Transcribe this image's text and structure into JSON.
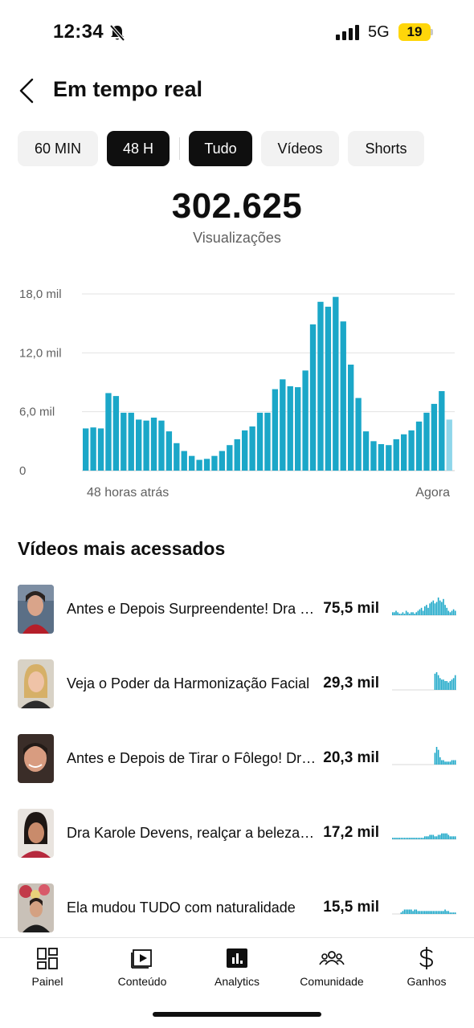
{
  "status_bar": {
    "time": "12:34",
    "network": "5G",
    "battery": "19"
  },
  "header": {
    "title": "Em tempo real"
  },
  "filters": {
    "range": [
      {
        "label": "60 MIN",
        "active": false
      },
      {
        "label": "48 H",
        "active": true
      }
    ],
    "content": [
      {
        "label": "Tudo",
        "active": true
      },
      {
        "label": "Vídeos",
        "active": false
      },
      {
        "label": "Shorts",
        "active": false
      }
    ]
  },
  "summary": {
    "total": "302.625",
    "label": "Visualizações"
  },
  "chart_data": {
    "type": "bar",
    "y_ticks": [
      "18,0 mil",
      "12,0 mil",
      "6,0 mil",
      "0"
    ],
    "ylim": [
      0,
      18000
    ],
    "x_start_label": "48 horas atrás",
    "x_end_label": "Agora",
    "values": [
      4300,
      4400,
      4300,
      7900,
      7600,
      5900,
      5900,
      5200,
      5100,
      5400,
      5100,
      4000,
      2800,
      2000,
      1500,
      1100,
      1200,
      1500,
      2000,
      2600,
      3200,
      4100,
      4500,
      5900,
      5900,
      8300,
      9300,
      8600,
      8500,
      10200,
      14900,
      17200,
      16700,
      17700,
      15200,
      10800,
      7400,
      4000,
      3000,
      2700,
      2600,
      3200,
      3700,
      4100,
      5000,
      5900,
      6800,
      8100,
      5200
    ],
    "bar_color": "#1ba7c8",
    "last_bar_color": "#8fd6ea",
    "grid": true
  },
  "top_videos": {
    "title": "Vídeos mais acessados",
    "items": [
      {
        "title": "Antes e Depois Surpreendente! Dra Karole Devens",
        "views": "75,5 mil",
        "spark": [
          2,
          2,
          3,
          2,
          1,
          1,
          2,
          1,
          3,
          2,
          1,
          2,
          2,
          1,
          2,
          3,
          4,
          5,
          3,
          6,
          7,
          5,
          8,
          9,
          10,
          8,
          9,
          12,
          10,
          9,
          11,
          7,
          5,
          3,
          2,
          3,
          4,
          3
        ]
      },
      {
        "title": "Veja o Poder da Harmonização Facial",
        "views": "29,3 mil",
        "spark": [
          0,
          0,
          0,
          0,
          0,
          0,
          0,
          0,
          0,
          0,
          0,
          0,
          0,
          0,
          0,
          0,
          0,
          0,
          0,
          0,
          0,
          0,
          0,
          0,
          0,
          11,
          12,
          10,
          8,
          7,
          7,
          6,
          6,
          5,
          6,
          7,
          8,
          10
        ]
      },
      {
        "title": "Antes e Depois de Tirar o Fôlego! Dra Karole",
        "views": "20,3 mil",
        "spark": [
          0,
          0,
          0,
          0,
          0,
          0,
          0,
          0,
          0,
          0,
          0,
          0,
          0,
          0,
          0,
          0,
          0,
          0,
          0,
          0,
          0,
          0,
          0,
          0,
          0,
          8,
          12,
          10,
          5,
          3,
          3,
          2,
          2,
          2,
          2,
          3,
          3,
          3
        ]
      },
      {
        "title": "Dra Karole Devens, realçar a beleza natural",
        "views": "17,2 mil",
        "spark": [
          1,
          1,
          1,
          1,
          1,
          1,
          1,
          1,
          1,
          1,
          1,
          1,
          1,
          1,
          1,
          1,
          1,
          1,
          1,
          2,
          2,
          2,
          3,
          3,
          3,
          2,
          2,
          3,
          3,
          4,
          4,
          4,
          4,
          3,
          2,
          2,
          2,
          2
        ]
      },
      {
        "title": "Ela mudou TUDO com naturalidade",
        "views": "15,5 mil",
        "spark": [
          0,
          0,
          0,
          0,
          0,
          1,
          2,
          3,
          3,
          3,
          3,
          3,
          2,
          3,
          3,
          2,
          2,
          2,
          2,
          2,
          2,
          2,
          2,
          2,
          2,
          2,
          2,
          2,
          2,
          2,
          2,
          3,
          2,
          2,
          1,
          1,
          1,
          1
        ]
      }
    ]
  },
  "nav": [
    {
      "label": "Painel",
      "icon": "dashboard-icon"
    },
    {
      "label": "Conteúdo",
      "icon": "content-icon"
    },
    {
      "label": "Analytics",
      "icon": "analytics-icon"
    },
    {
      "label": "Comunidade",
      "icon": "community-icon"
    },
    {
      "label": "Ganhos",
      "icon": "earnings-icon"
    }
  ]
}
